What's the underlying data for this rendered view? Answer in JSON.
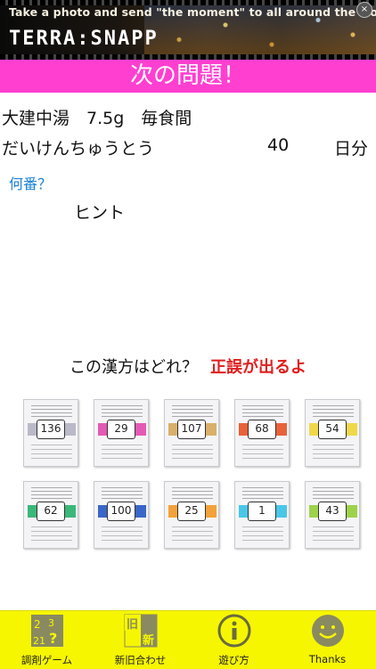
{
  "banner": {
    "tagline": "Take a photo and send \"the moment\" to all around the world!",
    "logo": "TERRA:SNAPP",
    "close_glyph": "×"
  },
  "header": {
    "title": "次の問題！"
  },
  "question": {
    "line1": "大建中湯　7.5g　毎食間",
    "reading": "だいけんちゅうとう",
    "days": "40",
    "unit": "日分",
    "which_link": "何番？",
    "hint": "ヒント"
  },
  "prompt": {
    "question": "この漢方はどれ？",
    "result_note": "正誤が出るよ"
  },
  "packages": [
    {
      "number": "136",
      "color": "#b9b9c8"
    },
    {
      "number": "29",
      "color": "#e35ab4"
    },
    {
      "number": "107",
      "color": "#d8b06a"
    },
    {
      "number": "68",
      "color": "#e8623a"
    },
    {
      "number": "54",
      "color": "#efd84a"
    },
    {
      "number": "62",
      "color": "#3ab87a"
    },
    {
      "number": "100",
      "color": "#3b66c8"
    },
    {
      "number": "25",
      "color": "#f2a23a"
    },
    {
      "number": "1",
      "color": "#4ac7e8"
    },
    {
      "number": "43",
      "color": "#9ed24a"
    }
  ],
  "tabs": [
    {
      "label": "調剤ゲーム",
      "icon": "dispensing-game-icon"
    },
    {
      "label": "新旧合わせ",
      "icon": "old-new-match-icon"
    },
    {
      "label": "遊び方",
      "icon": "info-icon"
    },
    {
      "label": "Thanks",
      "icon": "smiley-icon"
    }
  ],
  "colors": {
    "header": "#ff3fd0",
    "tabbar": "#f6f600",
    "link": "#1e82d8",
    "alert": "#e01e1e"
  }
}
